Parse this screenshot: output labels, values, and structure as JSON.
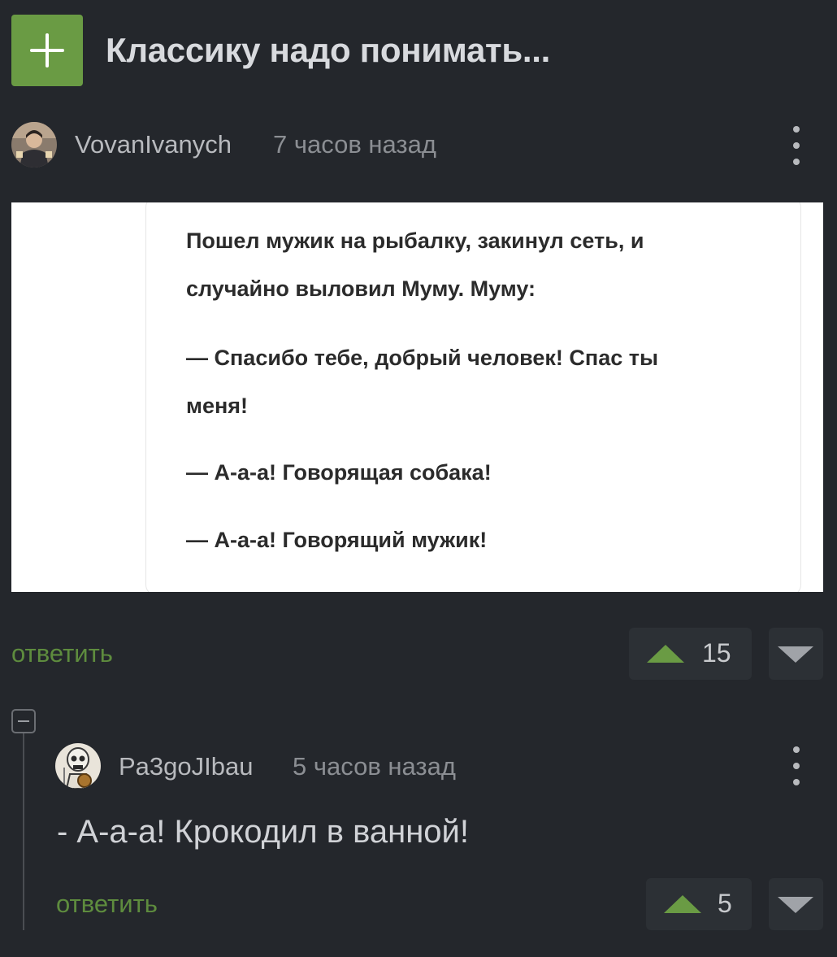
{
  "post": {
    "title": "Классику надо понимать..."
  },
  "comments": [
    {
      "username": "VovanIvanych",
      "time": "7 часов назад",
      "image_text": [
        "Пошел мужик на рыбалку, закинул сеть, и",
        "случайно выловил Муму. Муму:",
        "— Спасибо тебе, добрый человек! Спас ты",
        "меня!",
        "— А-а-а! Говорящая собака!",
        "— А-а-а! Говорящий мужик!"
      ],
      "reply_label": "ответить",
      "votes": "15"
    },
    {
      "username": "Pa3goJIbau",
      "time": "5 часов назад",
      "text": "- А-а-а! Крокодил в ванной!",
      "reply_label": "ответить",
      "votes": "5"
    }
  ],
  "icons": {
    "add": "plus-icon",
    "more": "kebab-menu-icon",
    "upvote": "triangle-up-icon",
    "downvote": "triangle-down-icon",
    "collapse": "minus-box-icon"
  },
  "colors": {
    "background": "#24272c",
    "accent_green": "#6a9b44",
    "reply_link": "#5e8c3e",
    "vote_box": "#2c3035"
  }
}
